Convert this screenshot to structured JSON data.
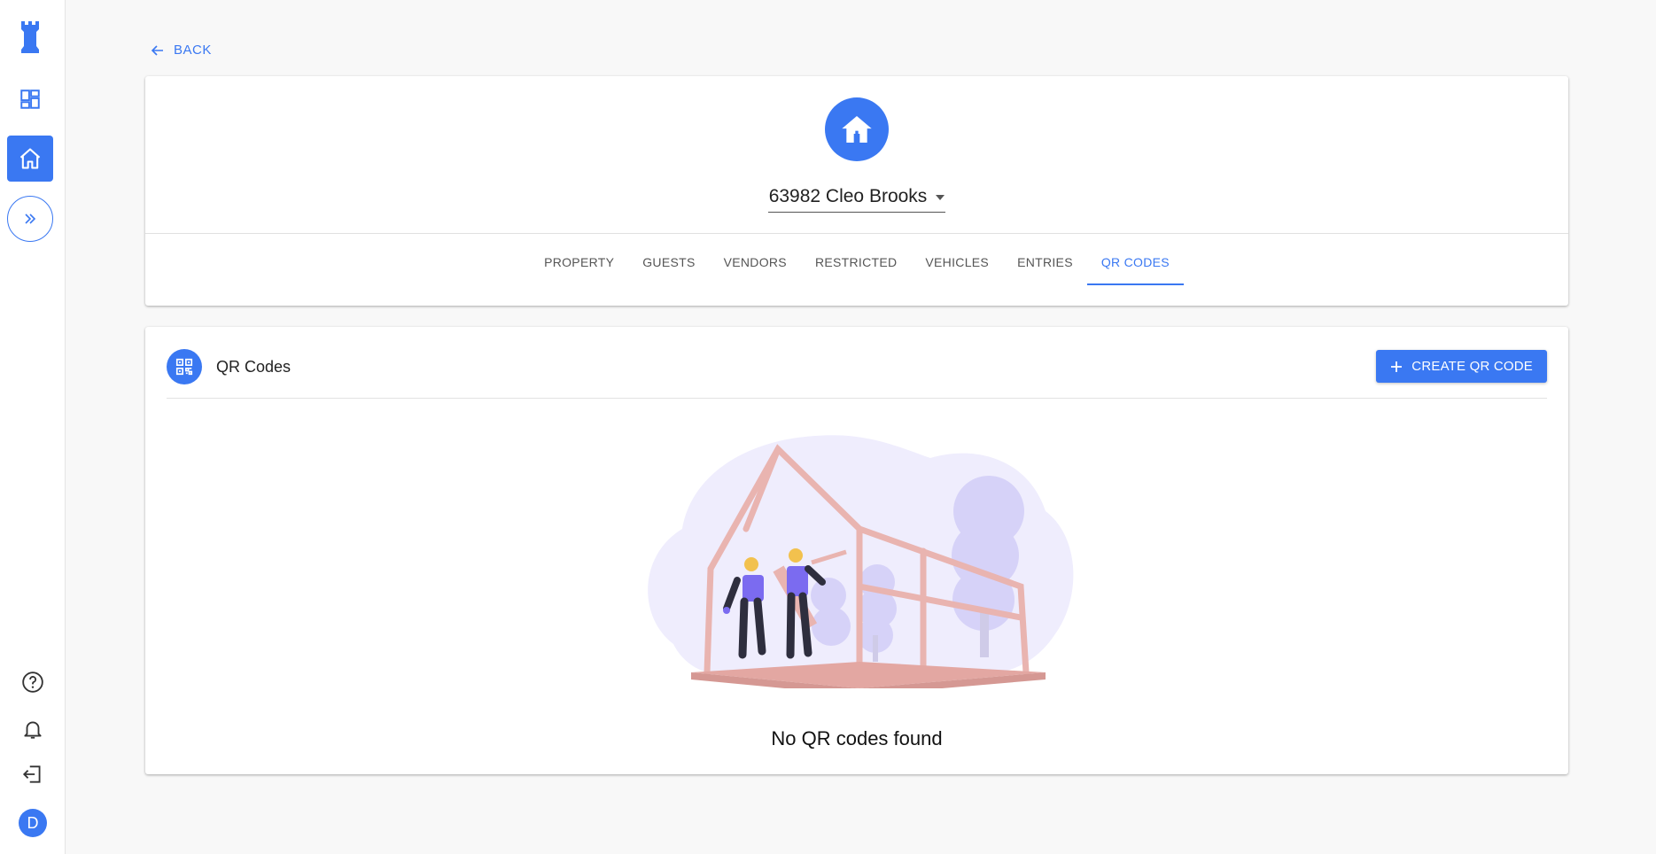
{
  "nav": {
    "back_label": "BACK"
  },
  "sidebar": {
    "items": [
      {
        "icon": "dashboard-icon"
      },
      {
        "icon": "home-icon"
      },
      {
        "icon": "expand-icon"
      }
    ],
    "bottom": [
      {
        "icon": "help-icon"
      },
      {
        "icon": "bell-icon"
      },
      {
        "icon": "logout-icon"
      }
    ],
    "avatar_initial": "D"
  },
  "property": {
    "name": "63982 Cleo Brooks"
  },
  "tabs": [
    {
      "label": "PROPERTY"
    },
    {
      "label": "GUESTS"
    },
    {
      "label": "VENDORS"
    },
    {
      "label": "RESTRICTED"
    },
    {
      "label": "VEHICLES"
    },
    {
      "label": "ENTRIES"
    },
    {
      "label": "QR CODES",
      "active": true
    }
  ],
  "qr_section": {
    "title": "QR Codes",
    "create_label": "CREATE QR CODE",
    "empty_message": "No QR codes found"
  },
  "colors": {
    "accent": "#3a78f2",
    "illustration_bg": "#efedfd",
    "frame": "#e9b4b0"
  }
}
